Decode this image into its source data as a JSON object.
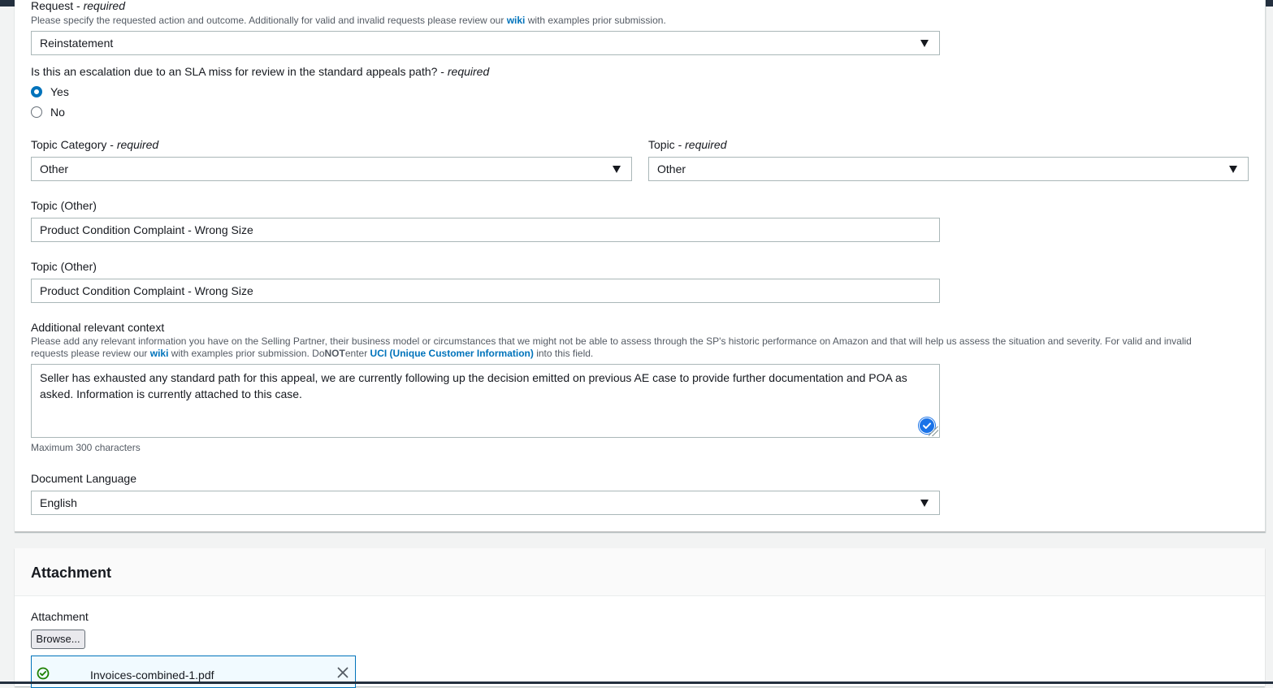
{
  "form": {
    "request": {
      "label": "Request",
      "required_suffix": "required",
      "description_pre": "Please specify the requested action and outcome. Additionally for valid and invalid requests please review our ",
      "description_link": "wiki",
      "description_post": " with examples prior submission.",
      "value": "Reinstatement"
    },
    "escalation": {
      "question": "Is this an escalation due to an SLA miss for review in the standard appeals path?",
      "required_suffix": "required",
      "options": [
        {
          "label": "Yes",
          "selected": true
        },
        {
          "label": "No",
          "selected": false
        }
      ]
    },
    "topic_category": {
      "label": "Topic Category",
      "required_suffix": "required",
      "value": "Other"
    },
    "topic": {
      "label": "Topic",
      "required_suffix": "required",
      "value": "Other"
    },
    "topic_other_1": {
      "label": "Topic (Other)",
      "value": "Product Condition Complaint - Wrong Size"
    },
    "topic_other_2": {
      "label": "Topic (Other)",
      "value": "Product Condition Complaint - Wrong Size"
    },
    "context": {
      "label": "Additional relevant context",
      "description_pre": "Please add any relevant information you have on the Selling Partner, their business model or circumstances that we might not be able to assess through the SP's historic performance on Amazon and that will help us assess the situation and severity. For valid and invalid requests please review our ",
      "description_link": "wiki",
      "description_mid": " with examples prior submission. Do",
      "description_bold": "NOT",
      "description_mid2": "enter ",
      "description_link2": "UCI (Unique Customer Information)",
      "description_post": " into this field.",
      "value": "Seller has exhausted any standard path for this appeal, we are currently following up the decision emitted on previous AE case to provide further documentation and POA as asked. Information is currently attached to this case.",
      "hint": "Maximum 300 characters"
    },
    "document_language": {
      "label": "Document Language",
      "value": "English"
    }
  },
  "attachment": {
    "section_title": "Attachment",
    "field_label": "Attachment",
    "browse_label": "Browse...",
    "file_name": "Invoices-combined-1.pdf"
  },
  "colors": {
    "link": "#0073bb",
    "radio_selected": "#0073bb",
    "header_bar": "#232f3e",
    "success": "#1d8102"
  }
}
